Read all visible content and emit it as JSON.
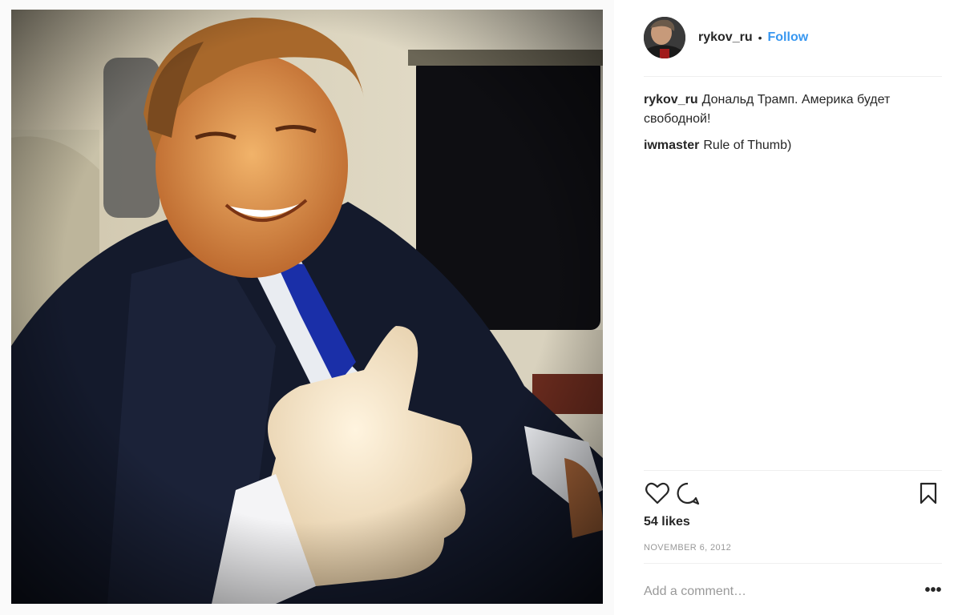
{
  "post": {
    "photo_icon": "photo-image",
    "avatar_icon": "user-avatar"
  },
  "header": {
    "username": "rykov_ru",
    "separator": "•",
    "follow_label": "Follow"
  },
  "comments": [
    {
      "user": "rykov_ru",
      "text": "Дональд Трамп. Америка будет свободной!"
    },
    {
      "user": "iwmaster",
      "text": "Rule of Thumb)"
    }
  ],
  "actions": {
    "like_icon": "heart-icon",
    "comment_icon": "comment-icon",
    "save_icon": "bookmark-icon"
  },
  "likes": "54 likes",
  "date": "NOVEMBER 6, 2012",
  "add_comment": {
    "placeholder": "Add a comment…",
    "value": "",
    "more_label": "•••"
  },
  "colors": {
    "accent": "#3897f0",
    "text": "#262626",
    "muted": "#999999",
    "divider": "#efefef"
  }
}
